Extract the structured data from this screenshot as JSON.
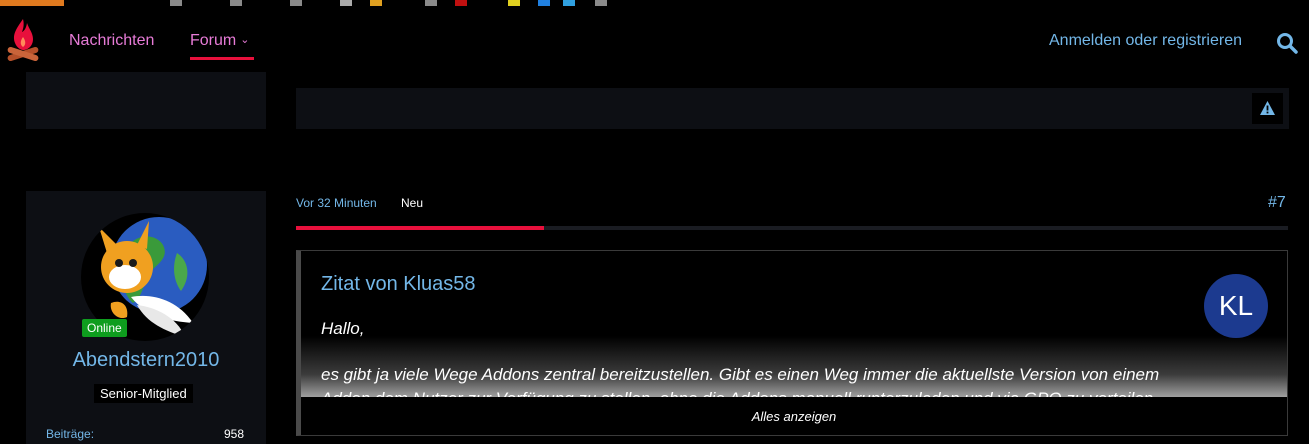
{
  "nav": {
    "items": [
      {
        "label": "Nachrichten"
      },
      {
        "label": "Forum",
        "active": true
      }
    ],
    "login_label": "Anmelden oder registrieren",
    "search_icon": "search-icon",
    "logo_icon": "campfire-logo-icon",
    "accent_color": "#e8103c",
    "link_color": "#73b7e8",
    "nav_color": "#e77bd7"
  },
  "post": {
    "time": "Vor 32 Minuten",
    "new_label": "Neu",
    "number": "#7",
    "read_progress": 0.25,
    "warning_icon": "warning-icon"
  },
  "author": {
    "username": "Abendstern2010",
    "online_label": "Online",
    "rank": "Senior-Mitglied",
    "stats": [
      {
        "label": "Beiträge:",
        "value": "958"
      }
    ]
  },
  "quote": {
    "title": "Zitat von Kluas58",
    "avatar_initials": "KL",
    "avatar_color": "#1c3a8f",
    "lines": [
      "Hallo,",
      "es gibt ja viele Wege Addons zentral bereitzustellen. Gibt es einen Weg immer die aktuellste Version von einem",
      "Addon dem Nutzer zur Verfügung zu stellen, ohne die Addons manuell runterzuladen und via GPO zu verteilen..."
    ],
    "show_all_label": "Alles anzeigen"
  }
}
